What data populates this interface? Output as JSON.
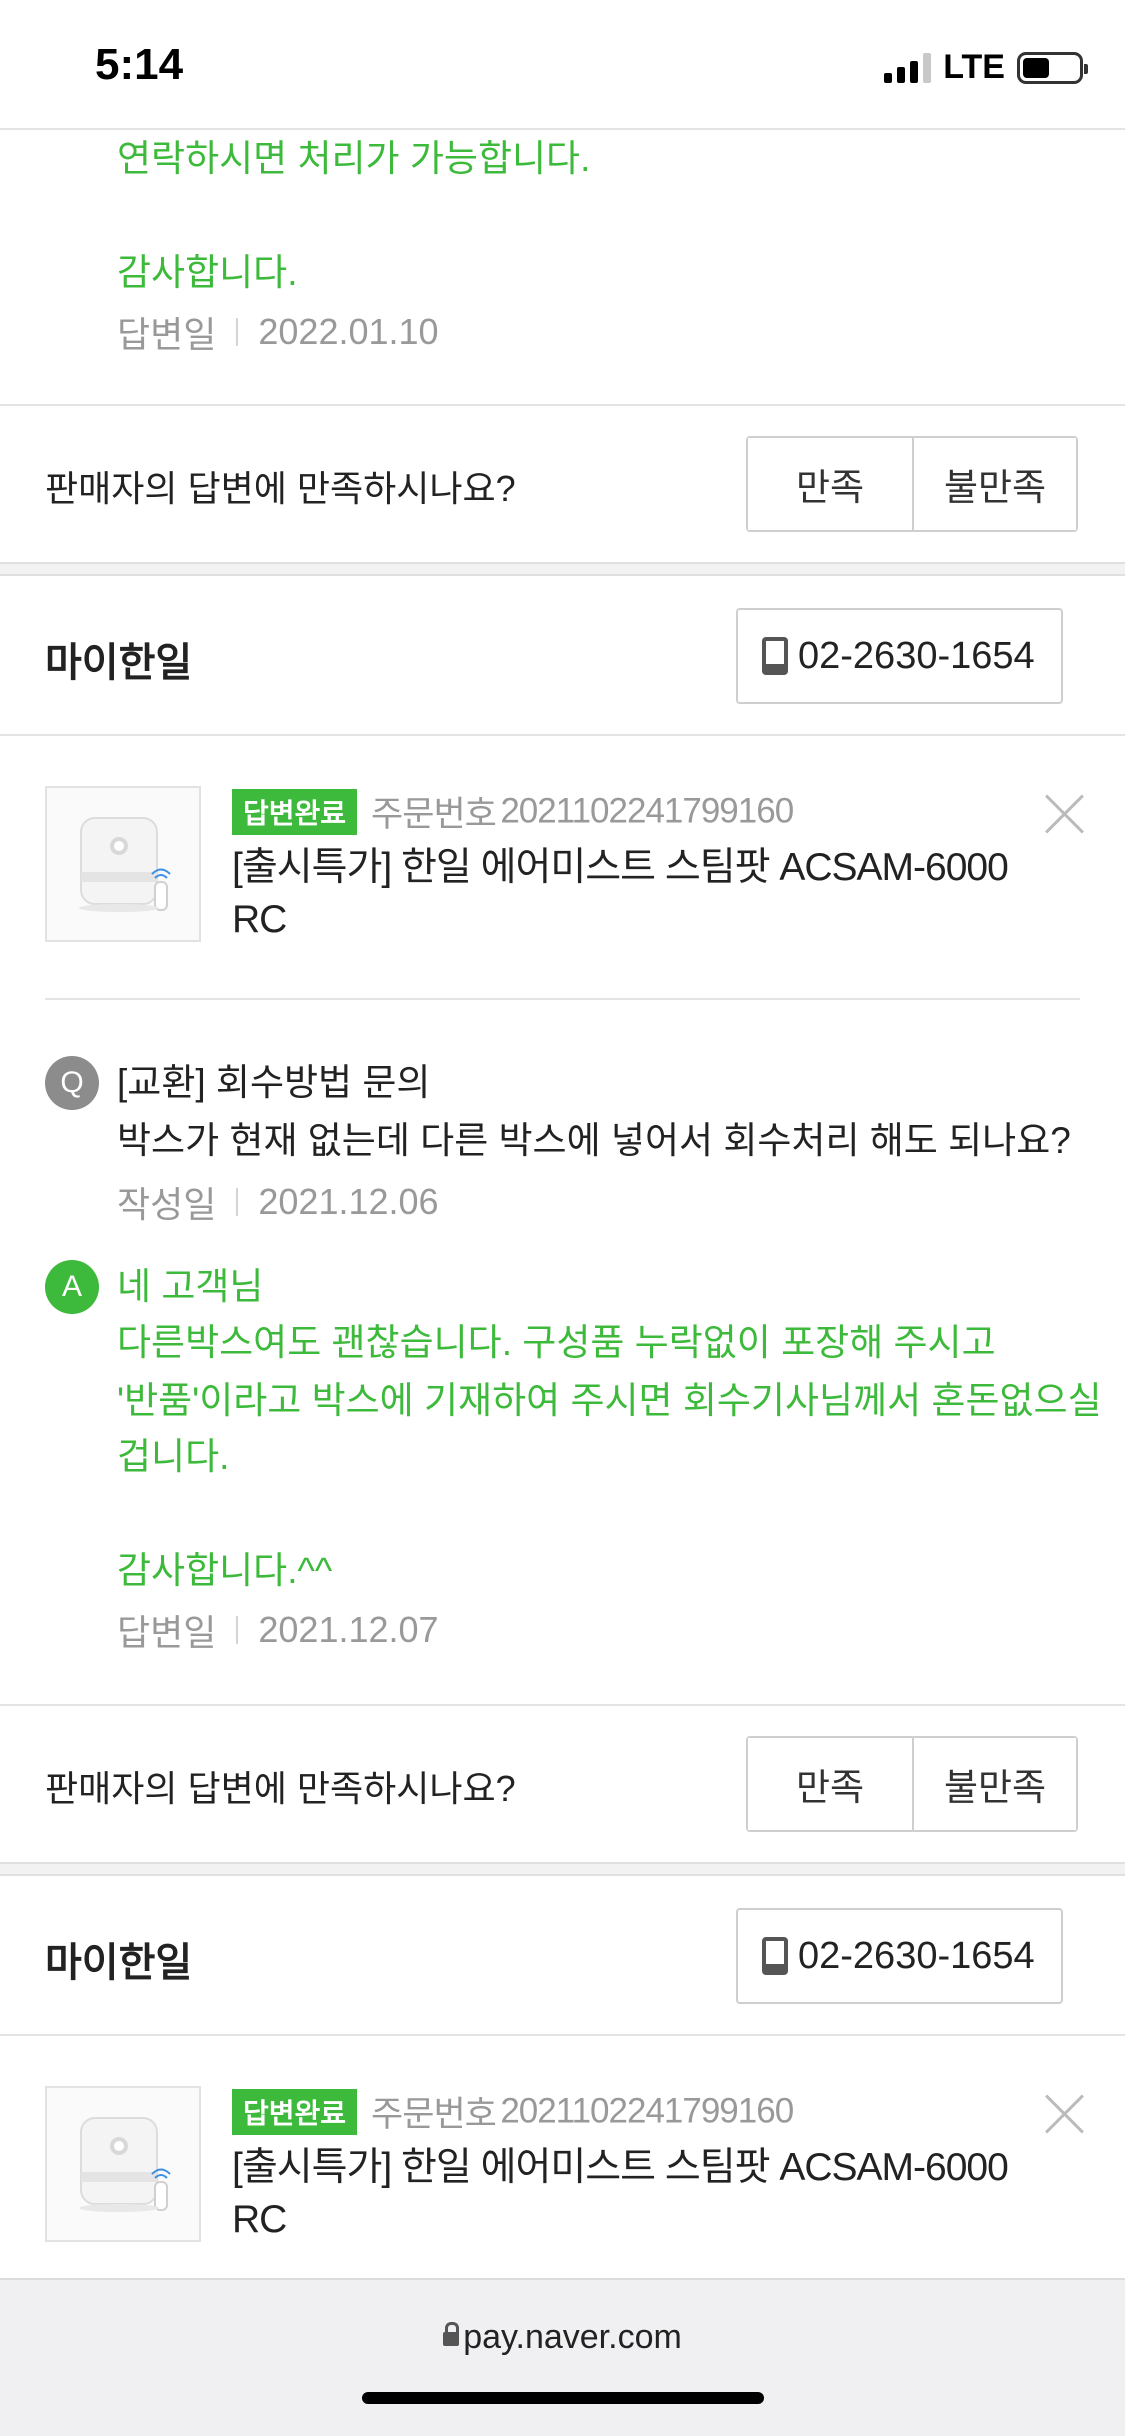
{
  "status_bar": {
    "time": "5:14",
    "network": "LTE"
  },
  "prev_answer": {
    "line1": "연락하시면 처리가 가능합니다.",
    "thanks": "감사합니다.",
    "date_label": "답변일",
    "date": "2022.01.10"
  },
  "satisfaction": {
    "question": "판매자의 답변에 만족하시나요?",
    "yes": "만족",
    "no": "불만족"
  },
  "seller": {
    "name": "마이한일",
    "phone": "02-2630-1654"
  },
  "inquiry1": {
    "badge": "답변완료",
    "order_label": "주문번호",
    "order_no": "2021102241799160",
    "product_line1": "[출시특가] 한일 에어미스트 스팀팟 ACSAM-6000",
    "product_line2": "RC",
    "q_marker": "Q",
    "q_title": "[교환] 회수방법 문의",
    "q_body": "박스가 현재 없는데 다른 박스에 넣어서 회수처리 해도 되나요?",
    "q_date_label": "작성일",
    "q_date": "2021.12.06",
    "a_marker": "A",
    "a_line1": "네 고객님",
    "a_line2": "다른박스여도 괜찮습니다. 구성품 누락없이 포장해 주시고",
    "a_line3": "'반품'이라고 박스에 기재하여 주시면 회수기사님께서 혼돈없으실",
    "a_line4": "겁니다.",
    "a_thanks": "감사합니다.^^",
    "a_date_label": "답변일",
    "a_date": "2021.12.07"
  },
  "inquiry2": {
    "badge": "답변완료",
    "order_label": "주문번호",
    "order_no": "2021102241799160",
    "product_line1": "[출시특가] 한일 에어미스트 스팀팟 ACSAM-6000",
    "product_line2": "RC"
  },
  "browser": {
    "url": "pay.naver.com"
  }
}
